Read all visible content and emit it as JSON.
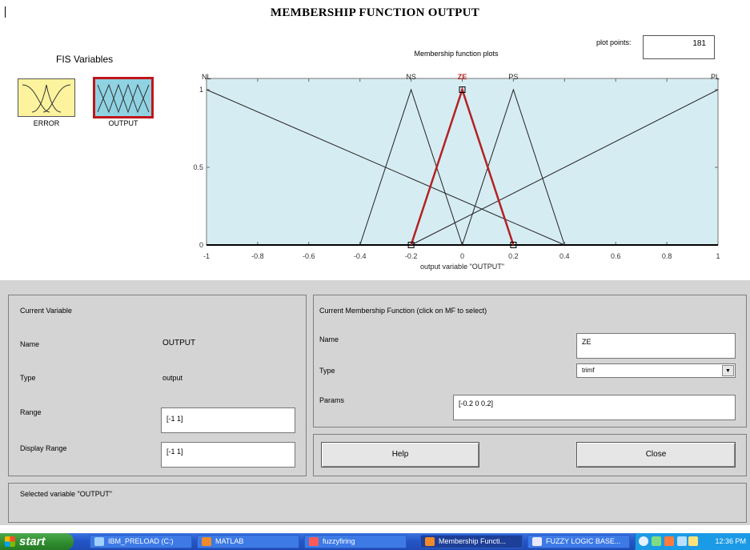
{
  "page": {
    "title": "MEMBERSHIP FUNCTION OUTPUT"
  },
  "fis_variables": {
    "heading": "FIS Variables",
    "items": [
      {
        "label": "ERROR",
        "color": "#fdf39e",
        "selected": false
      },
      {
        "label": "OUTPUT",
        "color": "#8fd3e3",
        "selected": true
      }
    ]
  },
  "plot": {
    "title": "Membership function plots",
    "plot_points_label": "plot points:",
    "plot_points_value": "181",
    "xlabel": "output variable \"OUTPUT\"",
    "y_ticks": [
      "0",
      "0.5",
      "1"
    ],
    "x_ticks": [
      "-1",
      "-0.8",
      "-0.6",
      "-0.4",
      "-0.2",
      "0",
      "0.2",
      "0.4",
      "0.6",
      "0.8",
      "1"
    ],
    "x_range": [
      -1,
      1
    ],
    "y_range": [
      0,
      1
    ],
    "background": "#d6ecf3",
    "selected_color": "#b22222",
    "mfs": [
      {
        "name": "NL",
        "params": [
          -1,
          -1,
          0.4
        ],
        "selected": false
      },
      {
        "name": "NS",
        "params": [
          -0.4,
          -0.2,
          0
        ],
        "selected": false
      },
      {
        "name": "ZE",
        "params": [
          -0.2,
          0,
          0.2
        ],
        "selected": true
      },
      {
        "name": "PS",
        "params": [
          0,
          0.2,
          0.4
        ],
        "selected": false
      },
      {
        "name": "PL",
        "params": [
          -0.2,
          1,
          1
        ],
        "selected": false
      }
    ]
  },
  "current_variable": {
    "heading": "Current Variable",
    "name_label": "Name",
    "name_value": "OUTPUT",
    "type_label": "Type",
    "type_value": "output",
    "range_label": "Range",
    "range_value": "[-1 1]",
    "display_range_label": "Display Range",
    "display_range_value": "[-1 1]"
  },
  "current_mf": {
    "heading": "Current Membership Function (click on MF to select)",
    "name_label": "Name",
    "name_value": "ZE",
    "type_label": "Type",
    "type_value": "trimf",
    "params_label": "Params",
    "params_value": "[-0.2 0 0.2]"
  },
  "buttons": {
    "help": "Help",
    "close": "Close"
  },
  "status": {
    "text": "Selected variable \"OUTPUT\""
  },
  "taskbar": {
    "start_label": "start",
    "items": [
      {
        "label": "IBM_PRELOAD (C:)",
        "icon_color": "#9fd0ff",
        "active": false
      },
      {
        "label": "MATLAB",
        "icon_color": "#f08a2a",
        "active": false
      },
      {
        "label": "fuzzyfiring",
        "icon_color": "#ff5a5a",
        "active": false
      },
      {
        "label": "Membership Functi...",
        "icon_color": "#f08a2a",
        "active": true
      },
      {
        "label": "FUZZY LOGIC BASE...",
        "icon_color": "#e8e8ff",
        "active": false
      }
    ],
    "clock": "12:36 PM"
  }
}
